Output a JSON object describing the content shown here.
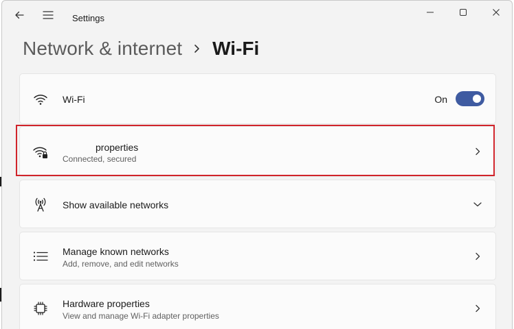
{
  "window": {
    "title": "Settings",
    "controls": [
      "minimize",
      "maximize",
      "close"
    ]
  },
  "breadcrumb": {
    "parent": "Network & internet",
    "separator": "chevron-right-icon",
    "current": "Wi-Fi"
  },
  "settings": {
    "wifi": {
      "label": "Wi-Fi",
      "icon": "wifi-icon",
      "state": "On",
      "enabled": true
    },
    "properties": {
      "label": "properties",
      "sub": "Connected, secured",
      "icon": "wifi-secured-icon"
    },
    "available": {
      "label": "Show available networks",
      "icon": "antenna-icon"
    },
    "known": {
      "label": "Manage known networks",
      "sub": "Add, remove, and edit networks",
      "icon": "list-icon"
    },
    "hardware": {
      "label": "Hardware properties",
      "sub": "View and manage Wi-Fi adapter properties",
      "icon": "chip-icon"
    }
  },
  "colors": {
    "accent": "#3f5ba1",
    "highlight": "#d0232a",
    "background": "#f3f3f3",
    "card": "#fbfbfb"
  }
}
